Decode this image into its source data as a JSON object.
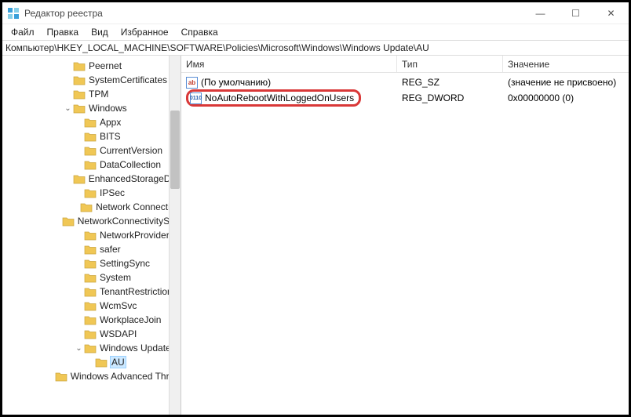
{
  "window": {
    "title": "Редактор реестра",
    "minimize_glyph": "—",
    "maximize_glyph": "☐",
    "close_glyph": "✕"
  },
  "menu": {
    "file": "Файл",
    "edit": "Правка",
    "view": "Вид",
    "favorites": "Избранное",
    "help": "Справка"
  },
  "address": "Компьютер\\HKEY_LOCAL_MACHINE\\SOFTWARE\\Policies\\Microsoft\\Windows\\Windows Update\\AU",
  "tree": [
    {
      "level": 5,
      "expand": "",
      "label": "Peernet"
    },
    {
      "level": 5,
      "expand": "",
      "label": "SystemCertificates"
    },
    {
      "level": 5,
      "expand": "",
      "label": "TPM"
    },
    {
      "level": 5,
      "expand": "open",
      "label": "Windows"
    },
    {
      "level": 6,
      "expand": "",
      "label": "Appx"
    },
    {
      "level": 6,
      "expand": "",
      "label": "BITS"
    },
    {
      "level": 6,
      "expand": "",
      "label": "CurrentVersion"
    },
    {
      "level": 6,
      "expand": "",
      "label": "DataCollection"
    },
    {
      "level": 6,
      "expand": "",
      "label": "EnhancedStorageDevices"
    },
    {
      "level": 6,
      "expand": "",
      "label": "IPSec"
    },
    {
      "level": 6,
      "expand": "",
      "label": "Network Connections"
    },
    {
      "level": 6,
      "expand": "",
      "label": "NetworkConnectivityStatusIndicator"
    },
    {
      "level": 6,
      "expand": "",
      "label": "NetworkProvider"
    },
    {
      "level": 6,
      "expand": "",
      "label": "safer"
    },
    {
      "level": 6,
      "expand": "",
      "label": "SettingSync"
    },
    {
      "level": 6,
      "expand": "",
      "label": "System"
    },
    {
      "level": 6,
      "expand": "",
      "label": "TenantRestrictions"
    },
    {
      "level": 6,
      "expand": "",
      "label": "WcmSvc"
    },
    {
      "level": 6,
      "expand": "",
      "label": "WorkplaceJoin"
    },
    {
      "level": 6,
      "expand": "",
      "label": "WSDAPI"
    },
    {
      "level": 6,
      "expand": "open",
      "label": "Windows Update"
    },
    {
      "level": 7,
      "expand": "",
      "label": "AU",
      "selected": true
    },
    {
      "level": 5,
      "expand": "",
      "label": "Windows Advanced Threat Protection"
    }
  ],
  "columns": {
    "name": "Имя",
    "type": "Тип",
    "value": "Значение"
  },
  "values": [
    {
      "icon": "sz",
      "icon_text": "ab",
      "name": "(По умолчанию)",
      "type": "REG_SZ",
      "data": "(значение не присвоено)",
      "highlight": false
    },
    {
      "icon": "dw",
      "icon_text": "011\n110",
      "name": "NoAutoRebootWithLoggedOnUsers",
      "type": "REG_DWORD",
      "data": "0x00000000 (0)",
      "highlight": true
    }
  ]
}
